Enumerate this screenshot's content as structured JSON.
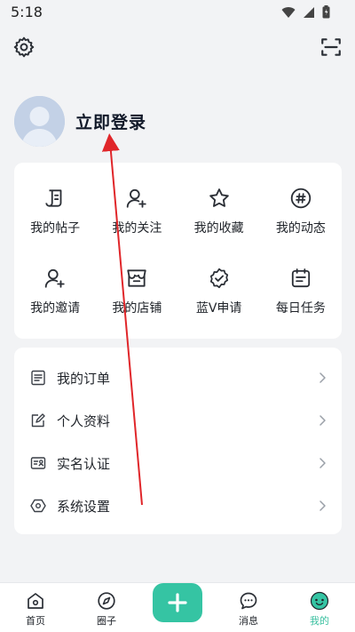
{
  "status_bar": {
    "time": "5:18"
  },
  "header": {
    "settings_icon": "gear-icon",
    "scan_icon": "scan-icon"
  },
  "profile": {
    "login_label": "立即登录"
  },
  "grid": {
    "items": [
      {
        "label": "我的帖子",
        "icon": "post-icon"
      },
      {
        "label": "我的关注",
        "icon": "follow-icon"
      },
      {
        "label": "我的收藏",
        "icon": "star-icon"
      },
      {
        "label": "我的动态",
        "icon": "hashtag-icon"
      },
      {
        "label": "我的邀请",
        "icon": "invite-icon"
      },
      {
        "label": "我的店铺",
        "icon": "store-icon"
      },
      {
        "label": "蓝V申请",
        "icon": "verified-icon"
      },
      {
        "label": "每日任务",
        "icon": "task-icon"
      }
    ]
  },
  "menu": {
    "items": [
      {
        "label": "我的订单",
        "icon": "order-icon"
      },
      {
        "label": "个人资料",
        "icon": "edit-profile-icon"
      },
      {
        "label": "实名认证",
        "icon": "id-card-icon"
      },
      {
        "label": "系统设置",
        "icon": "hexagon-settings-icon"
      }
    ]
  },
  "tabs": [
    {
      "label": "首页",
      "icon": "home-icon"
    },
    {
      "label": "圈子",
      "icon": "compass-icon"
    },
    {
      "label": "",
      "icon": "plus-icon"
    },
    {
      "label": "消息",
      "icon": "chat-icon"
    },
    {
      "label": "我的",
      "icon": "smile-icon",
      "active": true
    }
  ],
  "colors": {
    "accent": "#35c4a3",
    "annotation_arrow": "#e0262a"
  }
}
